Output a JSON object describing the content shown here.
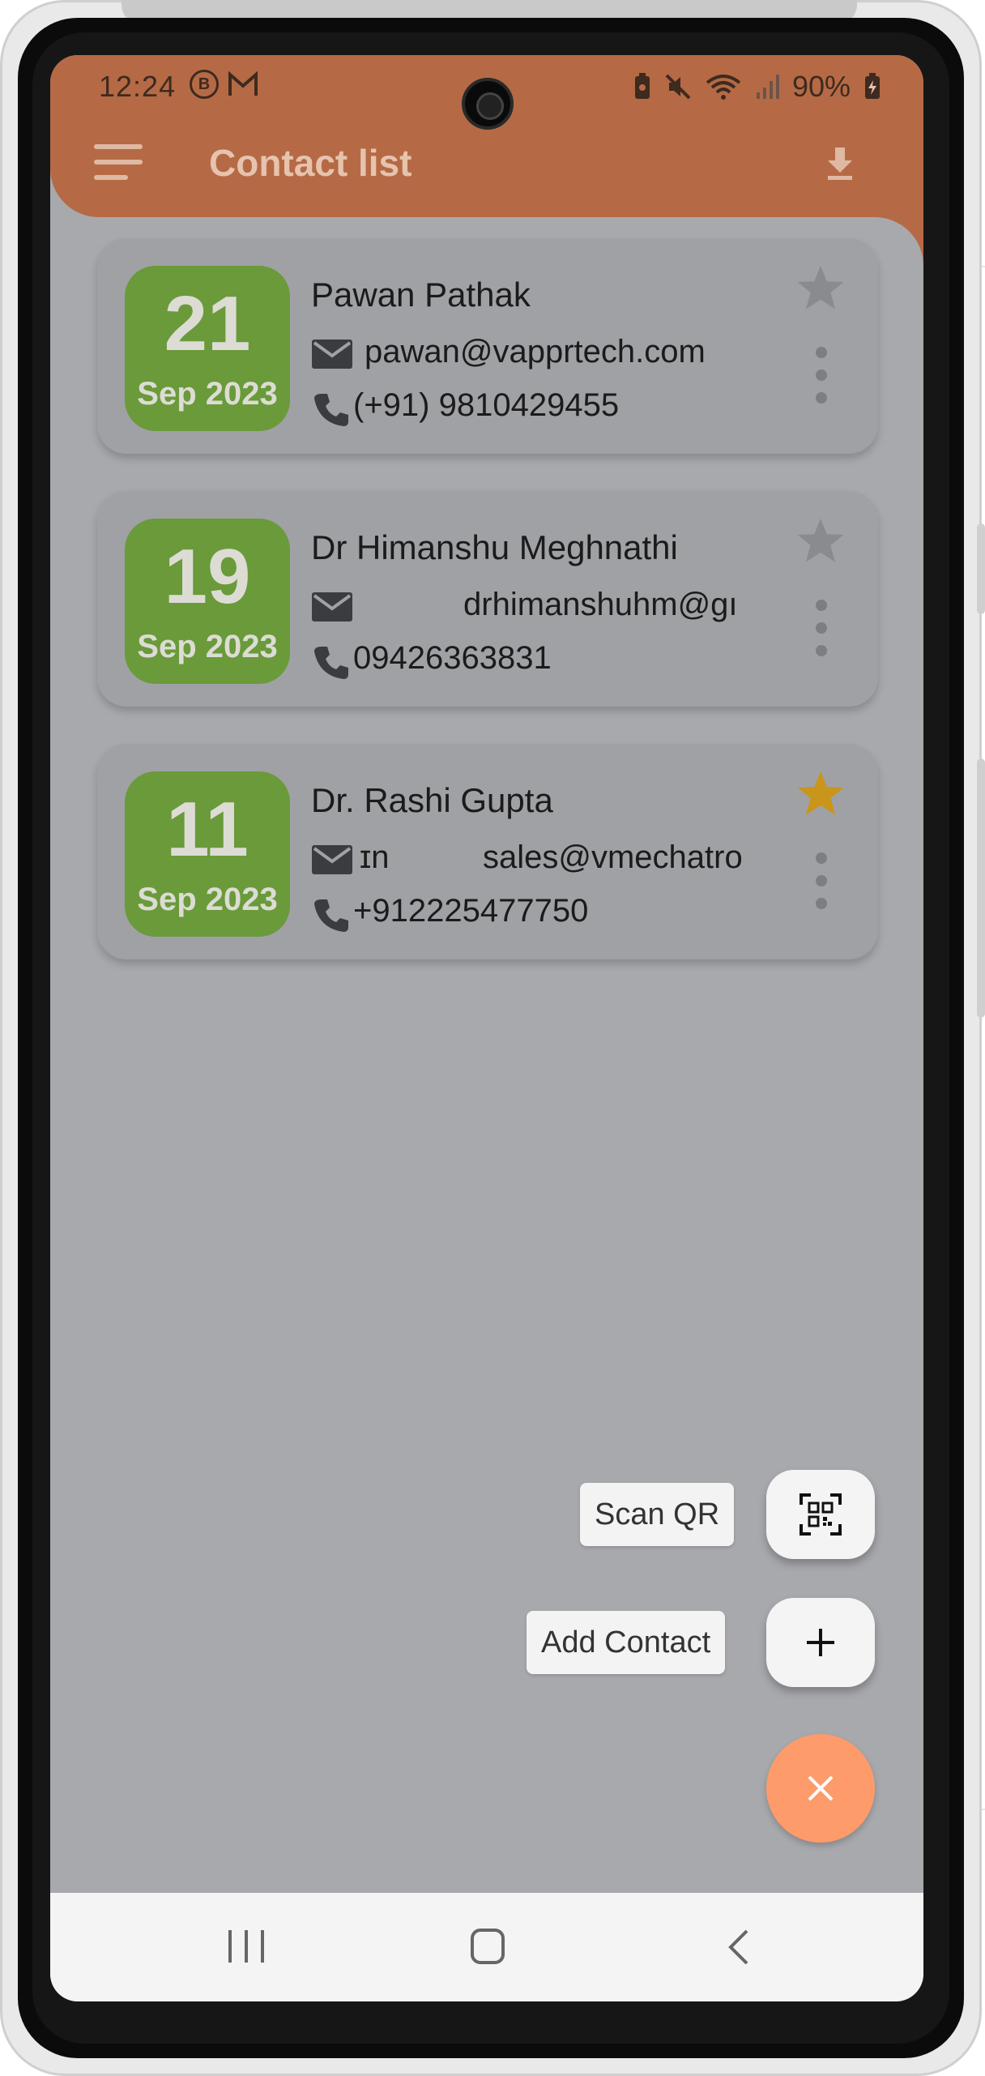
{
  "status_bar": {
    "time": "12:24",
    "left_icons": [
      "b-circle-icon",
      "gmail-icon"
    ],
    "battery": "90%",
    "right_icons": [
      "battery-saver-icon",
      "mute-icon",
      "wifi-icon",
      "signal-icon",
      "battery-charging-icon"
    ]
  },
  "app_bar": {
    "title": "Contact list",
    "menu_icon": "hamburger-menu-icon",
    "action_icon": "download-icon",
    "color": "#b56a45"
  },
  "contacts": [
    {
      "day": "21",
      "month_year": "Sep 2023",
      "name": "Pawan Pathak",
      "email": "pawan@vapprtech.com",
      "phone": "(+91) 9810429455",
      "starred": false
    },
    {
      "day": "19",
      "month_year": "Sep 2023",
      "name": "Dr Himanshu Meghnathi",
      "email": "drhimanshuhm@gı",
      "phone": "09426363831",
      "starred": false
    },
    {
      "day": "11",
      "month_year": "Sep 2023",
      "name": "Dr. Rashi Gupta",
      "email_prefix": "ɪn",
      "email": "sales@vmechatro",
      "phone": "+912225477750",
      "starred": true
    }
  ],
  "fab_menu": {
    "scan_label": "Scan QR",
    "scan_icon": "qr-scan-icon",
    "add_label": "Add Contact",
    "add_icon": "plus-icon",
    "close_icon": "close-icon"
  },
  "colors": {
    "date_badge": "#6a9a3a",
    "star_active": "#c9951a",
    "star_inactive": "#8a8b8f",
    "fab_main": "#fd9b6a",
    "overlay": "#a8a9ad"
  },
  "nav_bar": {
    "icons": [
      "recents-icon",
      "home-icon",
      "back-icon"
    ]
  }
}
